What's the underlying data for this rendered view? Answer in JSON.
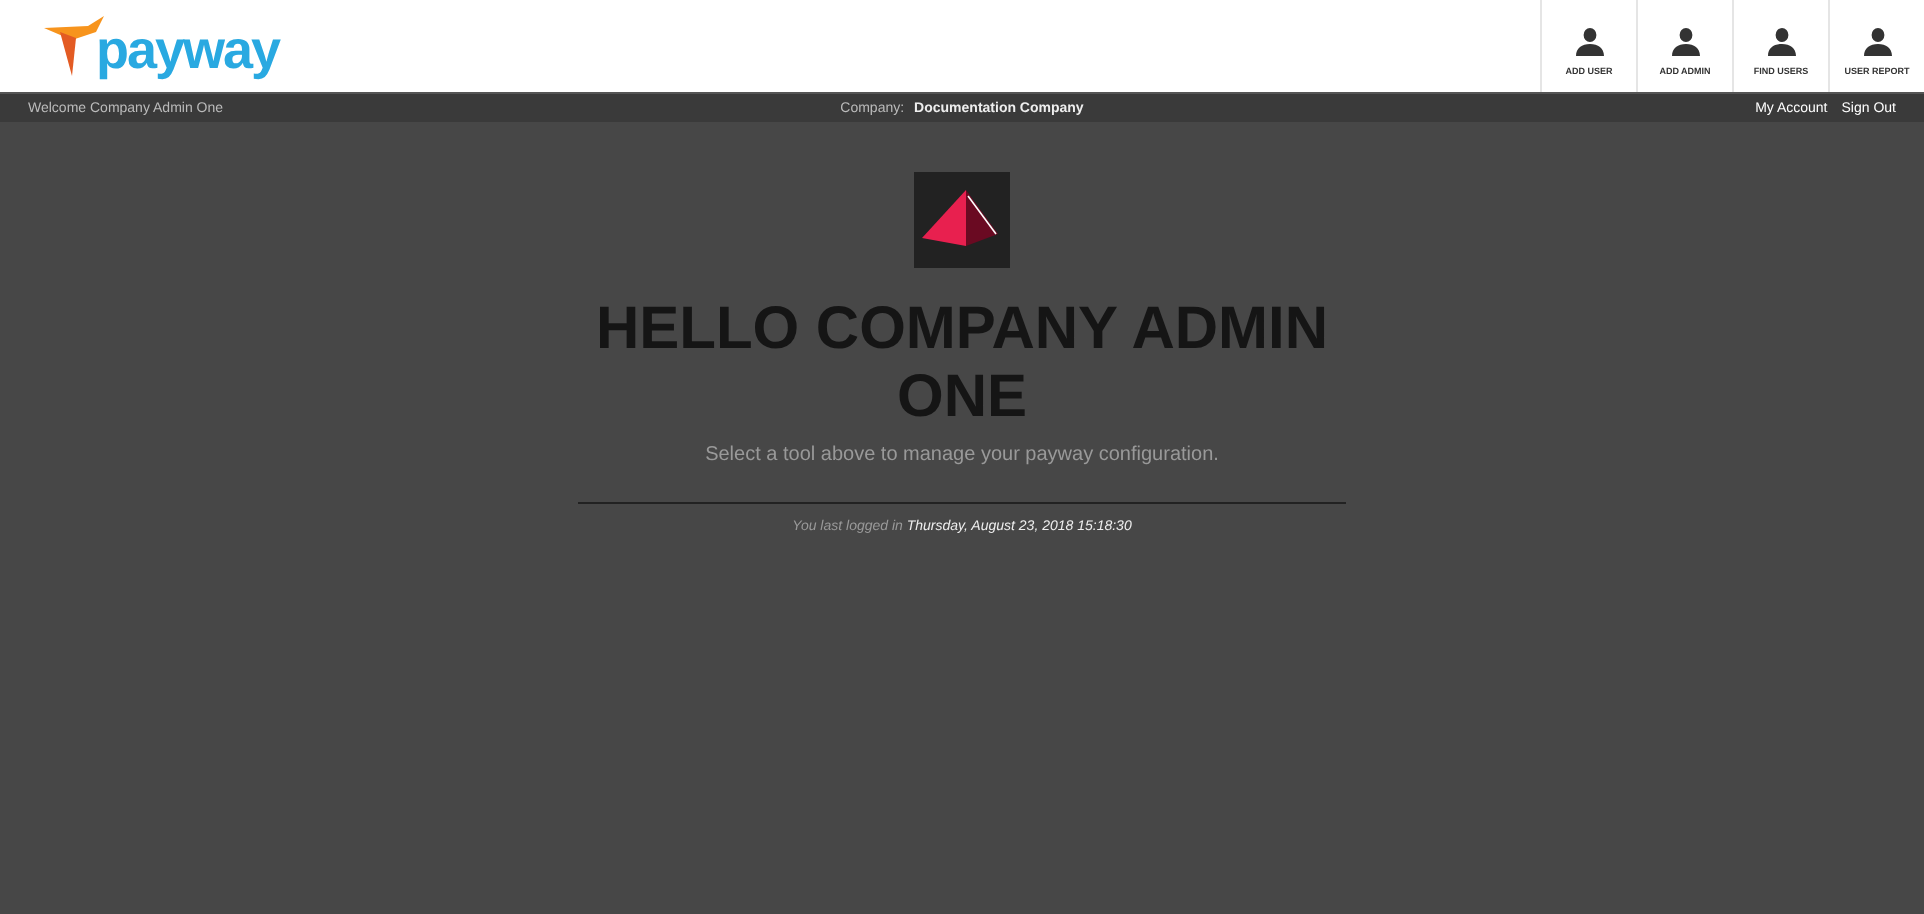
{
  "header": {
    "logo_text": "payway",
    "tools": [
      {
        "label": "ADD USER"
      },
      {
        "label": "ADD ADMIN"
      },
      {
        "label": "FIND USERS"
      },
      {
        "label": "USER REPORT"
      }
    ]
  },
  "subbar": {
    "welcome": "Welcome Company Admin One",
    "company_label": "Company:",
    "company": "Documentation Company",
    "links": [
      "My Account",
      "Sign Out"
    ]
  },
  "main": {
    "heading": "HELLO COMPANY ADMIN ONE",
    "subtitle": "Select a tool above to manage your payway configuration.",
    "last_login_label": "You last logged in",
    "last_login": "Thursday, August 23, 2018 15:18:30"
  }
}
